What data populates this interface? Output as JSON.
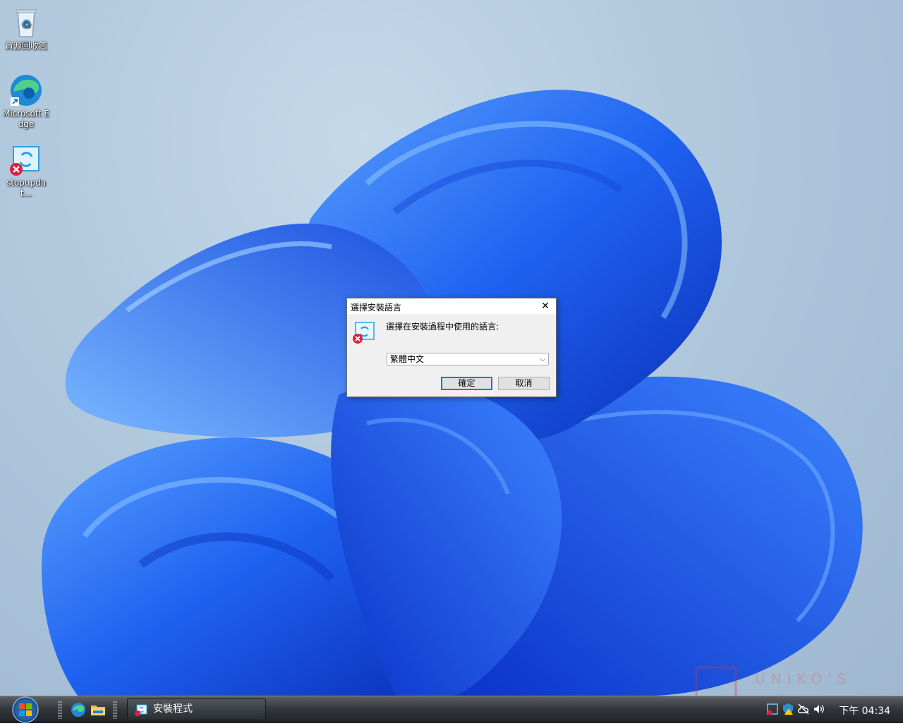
{
  "desktop": {
    "icons": [
      {
        "label": "資源回收筒",
        "icon": "recycle-bin-icon"
      },
      {
        "label": "Microsoft Edge",
        "icon": "edge-icon"
      },
      {
        "label": "stopupdat...",
        "icon": "setup-icon"
      }
    ]
  },
  "dialog": {
    "title": "選擇安裝語言",
    "close_label": "✕",
    "prompt": "選擇在安裝過程中使用的語言:",
    "language_select": {
      "value": "繁體中文"
    },
    "ok_label": "確定",
    "cancel_label": "取消"
  },
  "taskbar": {
    "task_button_label": "安裝程式",
    "clock": "下午 04:34"
  },
  "watermark": {
    "text": "UNIKO'S"
  },
  "colors": {
    "dialog_bg": "#f0f0f0",
    "accent": "#0078d7",
    "taskbar": "#2a2e32"
  }
}
